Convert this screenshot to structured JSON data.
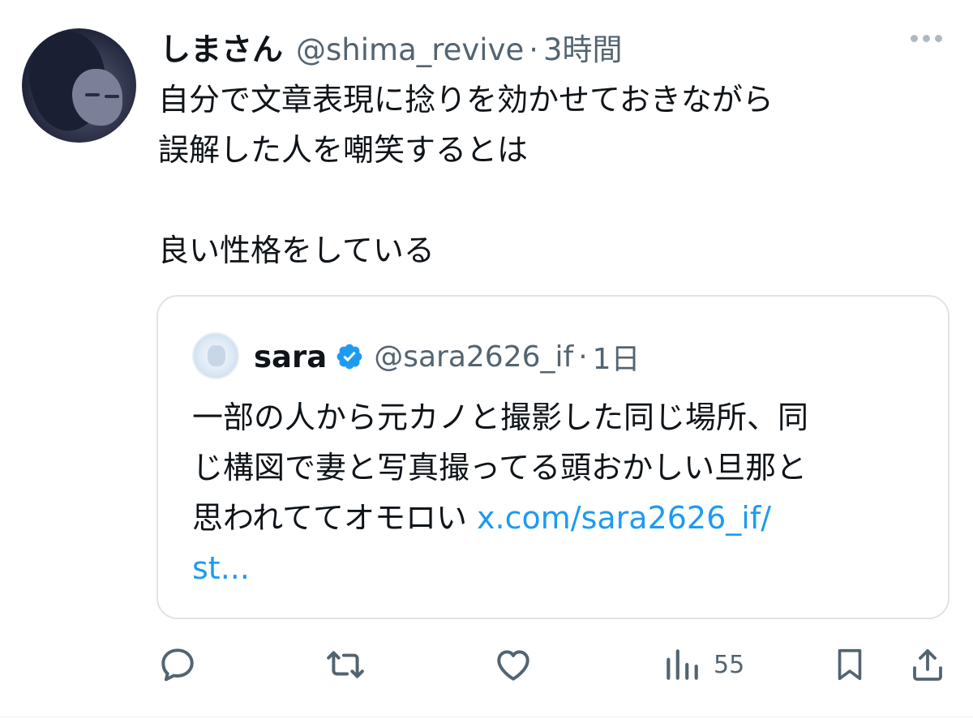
{
  "post": {
    "author_name": "しまさん",
    "author_handle": "@shima_revive",
    "separator": "·",
    "time": "3時間",
    "more_icon": "more-horizontal-icon",
    "text_lines": [
      "自分で文章表現に捻りを効かせておきながら",
      "誤解した人を嘲笑するとは",
      "",
      "良い性格をしている"
    ]
  },
  "quote": {
    "author_name": "sara",
    "verified_icon": "verified-badge-icon",
    "author_handle": "@sara2626_if",
    "separator": "·",
    "time": "1日",
    "text_line1": "一部の人から元カノと撮影した同じ場所、同",
    "text_line2": "じ構図で妻と写真撮ってる頭おかしい旦那と",
    "text_line3": "思われててオモロい ",
    "link_part1": "x.com/sara2626_if/",
    "link_part2": "st..."
  },
  "actions": {
    "reply_icon": "reply-icon",
    "repost_icon": "repost-icon",
    "like_icon": "like-icon",
    "views_icon": "views-icon",
    "views_count": "55",
    "bookmark_icon": "bookmark-icon",
    "share_icon": "share-icon"
  },
  "colors": {
    "text": "#0f1419",
    "secondary": "#536471",
    "link": "#1d9bf0",
    "verified": "#1d9bf0",
    "border": "#dfe3e7"
  }
}
